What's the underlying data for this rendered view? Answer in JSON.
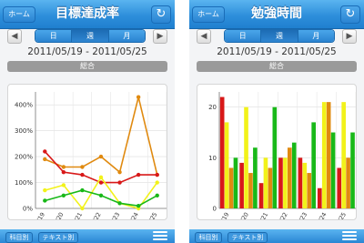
{
  "left": {
    "nav": {
      "home_label": "ホーム",
      "title": "目標達成率"
    },
    "period_tabs": [
      {
        "label": "日"
      },
      {
        "label": "週"
      },
      {
        "label": "月"
      }
    ],
    "date_range": "2011/05/19 - 2011/05/25",
    "section_label": "総合",
    "bottom": {
      "subject_label": "科目別",
      "text_label": "テキスト別"
    }
  },
  "right": {
    "nav": {
      "home_label": "ホーム",
      "title": "勉強時間"
    },
    "period_tabs": [
      {
        "label": "日"
      },
      {
        "label": "週"
      },
      {
        "label": "月"
      }
    ],
    "date_range": "2011/05/19 - 2011/05/25",
    "section_label": "総合",
    "bottom": {
      "subject_label": "科目別",
      "text_label": "テキスト別"
    }
  },
  "chart_data": [
    {
      "type": "line",
      "title": "目標達成率",
      "categories": [
        "05/19",
        "05/20",
        "05/21",
        "05/22",
        "05/23",
        "05/24",
        "05/25"
      ],
      "tick_labels": [
        "5/19",
        "5/20",
        "5/21",
        "5/22",
        "5/23",
        "5/24",
        "5/25"
      ],
      "y_ticks": [
        "0%",
        "100%",
        "200%",
        "300%",
        "400%"
      ],
      "ylim": [
        0,
        450
      ],
      "grid": true,
      "series": [
        {
          "color": "#e08a10",
          "values": [
            190,
            160,
            160,
            200,
            140,
            430,
            130
          ]
        },
        {
          "color": "#d81818",
          "values": [
            220,
            140,
            130,
            100,
            100,
            130,
            130
          ]
        },
        {
          "color": "#f2f21a",
          "values": [
            70,
            90,
            0,
            120,
            20,
            0,
            100
          ]
        },
        {
          "color": "#18b818",
          "values": [
            30,
            50,
            70,
            50,
            20,
            10,
            50
          ]
        }
      ]
    },
    {
      "type": "bar",
      "title": "勉強時間",
      "categories": [
        "05/19",
        "05/20",
        "05/21",
        "05/22",
        "05/23",
        "05/24",
        "05/25"
      ],
      "tick_labels": [
        "5/19",
        "5/20",
        "5/21",
        "5/22",
        "5/23",
        "5/24",
        "5/25"
      ],
      "y_ticks": [
        "0",
        "10",
        "20"
      ],
      "ylim": [
        0,
        23
      ],
      "grid": true,
      "series": [
        {
          "color": "#d81818",
          "values": [
            22,
            9,
            5,
            10,
            10,
            4,
            8
          ]
        },
        {
          "color": "#f2f21a",
          "values": [
            17,
            20,
            10,
            10,
            9,
            21,
            21
          ]
        },
        {
          "color": "#e08a10",
          "values": [
            8,
            7,
            8,
            12,
            7,
            21,
            10
          ]
        },
        {
          "color": "#18b818",
          "values": [
            10,
            12,
            20,
            13,
            17,
            15,
            15
          ]
        }
      ]
    }
  ]
}
